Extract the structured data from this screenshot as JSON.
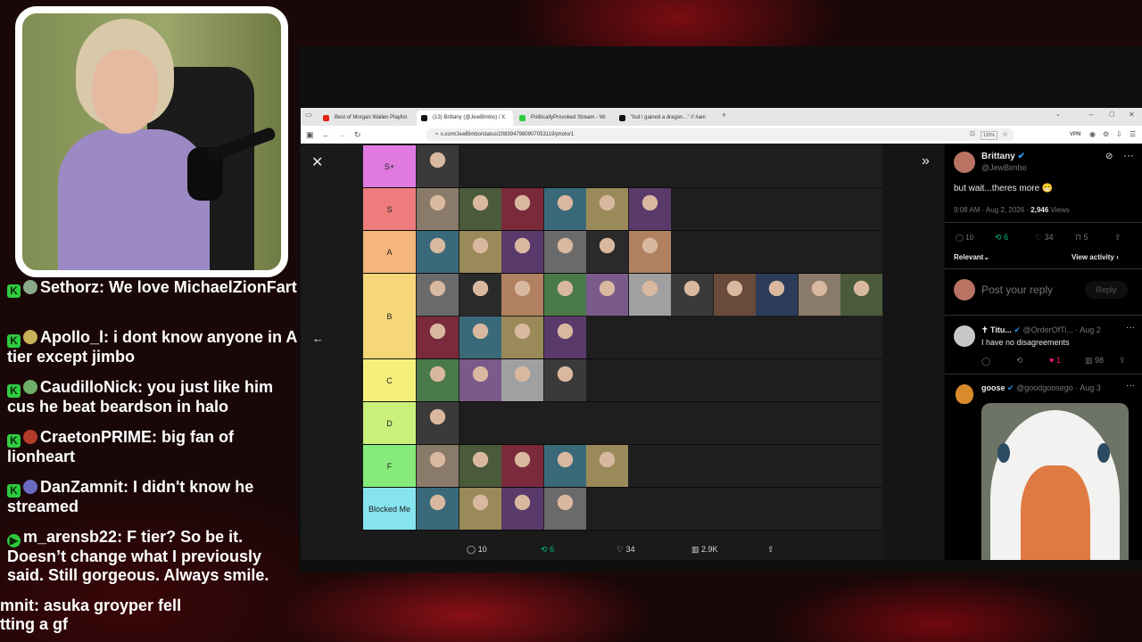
{
  "chat": {
    "messages": [
      {
        "user": "Sethorz",
        "text": "We love MichaelZionFart",
        "badge": "K"
      },
      {
        "user": "Apollo_l",
        "text": "i dont know anyone in A tier except jimbo",
        "badge": "K"
      },
      {
        "user": "CaudilloNick",
        "text": "you just like him cus he beat beardson in halo",
        "badge": "K"
      },
      {
        "user": "CraetonPRIME",
        "text": "big fan of lionheart",
        "badge": "K"
      },
      {
        "user": "DanZamnit",
        "text": "I didn't know he streamed",
        "badge": "K"
      },
      {
        "user": "m_arensb22",
        "text": "F tier? So be it. Doesn’t change what I previously said. Still gorgeous. Always smile.",
        "badge": "▶"
      },
      {
        "user": "mnit",
        "text": "asuka groyper fell",
        "line2": "tting a gf",
        "badge": ""
      }
    ]
  },
  "browser": {
    "tabs": [
      {
        "label": "Best of Morgan Wallen Playlist",
        "color": "#e62117"
      },
      {
        "label": "(13) Brittany (@JewBimbo) / X",
        "color": "#111111"
      },
      {
        "label": "PoliticallyProvoked Stream - Wi",
        "color": "#2ecc40"
      },
      {
        "label": "\"but i gained a dragon...\" // #ani",
        "color": "#111111"
      }
    ],
    "url": "x.com/JewBimbo/status/2083947980907053119/photo/1",
    "zoom": "130%",
    "vpn": "VPN"
  },
  "tier_list": {
    "rows": [
      {
        "label": "S+",
        "color": "#e07ae0",
        "count": 1
      },
      {
        "label": "S",
        "color": "#ee7c7c",
        "count": 6
      },
      {
        "label": "A",
        "color": "#f4b67a",
        "count": 6
      },
      {
        "label": "B",
        "color": "#f5d77a",
        "count": 15
      },
      {
        "label": "C",
        "color": "#f4f07a",
        "count": 4
      },
      {
        "label": "D",
        "color": "#c9f07a",
        "count": 1
      },
      {
        "label": "F",
        "color": "#86eb7a",
        "count": 5
      },
      {
        "label": "Blocked Me",
        "color": "#86e4ef",
        "count": 4
      }
    ]
  },
  "viewer_actions": {
    "replies": "10",
    "reposts": "6",
    "likes": "34",
    "views": "2.9K"
  },
  "tweet": {
    "name": "Brittany",
    "handle": "@JewBimbo",
    "text": "but wait...theres more 😁",
    "time": "9:08 AM · Aug 2, 2026 · ",
    "views": "2,946",
    "views_label": " Views",
    "replies": "10",
    "reposts": "6",
    "likes": "34",
    "bookmarks": "5",
    "relevant": "Relevant",
    "view_activity": "View activity",
    "reply_placeholder": "Post your reply",
    "reply_button": "Reply"
  },
  "replies": [
    {
      "name": "✝ Titu...",
      "handle": "@OrderOfTi... · Aug 2",
      "text": "I have no disagreements",
      "likes": "1",
      "views": "98"
    },
    {
      "name": "goose",
      "handle": "@goodgoosego · Aug 3"
    }
  ]
}
